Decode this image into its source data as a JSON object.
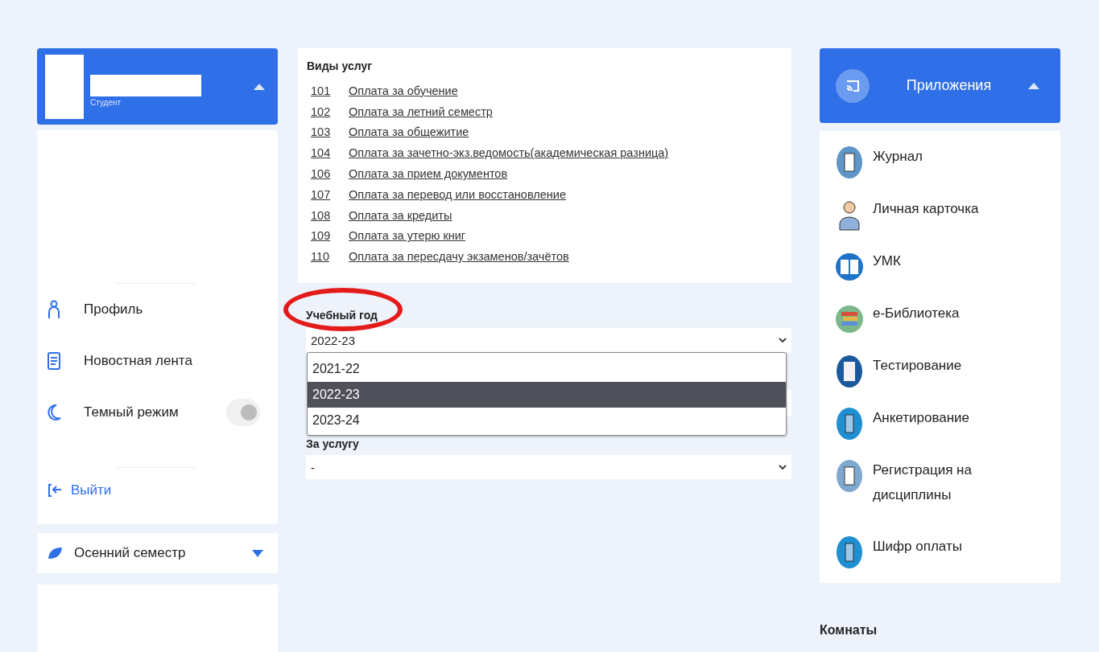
{
  "profile": {
    "role": "Студент",
    "expanded": true
  },
  "menu": [
    {
      "kind": "link",
      "label": "Профиль"
    },
    {
      "kind": "link",
      "label": "Новостная лента"
    },
    {
      "kind": "toggle",
      "label": "Темный режим",
      "on": false
    }
  ],
  "logout": {
    "label": "Выйти"
  },
  "semester": {
    "label": "Осенний семестр",
    "expanded": false
  },
  "services": {
    "title": "Виды услуг",
    "items": [
      {
        "code": "101",
        "label": "Оплата за обучение"
      },
      {
        "code": "102",
        "label": "Оплата за летний семестр"
      },
      {
        "code": "103",
        "label": "Оплата за общежитие"
      },
      {
        "code": "104",
        "label": "Оплата за зачетно-экз.ведомость(академическая разница)"
      },
      {
        "code": "106",
        "label": "Оплата за прием документов"
      },
      {
        "code": "107",
        "label": "Оплата за перевод или восстановление"
      },
      {
        "code": "108",
        "label": "Оплата за кредиты"
      },
      {
        "code": "109",
        "label": "Оплата за утерю книг"
      },
      {
        "code": "110",
        "label": "Оплата за пересдачу экзаменов/зачётов"
      }
    ]
  },
  "year_select": {
    "label": "Учебный год",
    "value": "2022-23",
    "open": true,
    "options": [
      {
        "label": "2021-22",
        "selected": false
      },
      {
        "label": "2022-23",
        "selected": true
      },
      {
        "label": "2023-24",
        "selected": false
      }
    ]
  },
  "service_select": {
    "label": "За услугу",
    "value": "-"
  },
  "apps": {
    "title": "Приложения",
    "expanded": true,
    "items": [
      {
        "label": "Журнал"
      },
      {
        "label": "Личная карточка"
      },
      {
        "label": "УМК"
      },
      {
        "label": "е-Библиотека"
      },
      {
        "label": "Тестирование"
      },
      {
        "label": "Анкетирование"
      },
      {
        "label": "Регистрация на дисциплины"
      },
      {
        "label": "Шифр оплаты"
      }
    ]
  },
  "rooms": {
    "title": "Комнаты"
  }
}
